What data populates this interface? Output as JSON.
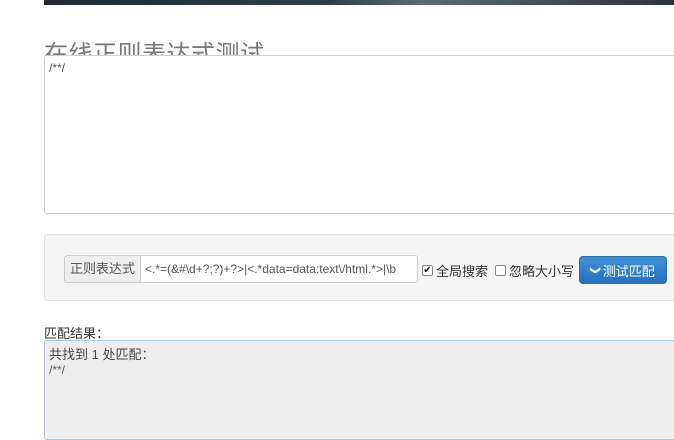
{
  "header": {
    "title": "在线正则表达式测试"
  },
  "source": {
    "text": "/**/"
  },
  "controls": {
    "regex_label": "正则表达式",
    "regex_value": "<.*=(&#\\d+?;?)+?>|<.*data=data:text\\/html.*>|\\b",
    "global_label": "全局搜索",
    "global_checked": true,
    "ignore_case_label": "忽略大小写",
    "ignore_case_checked": false,
    "match_button_label": "测试匹配",
    "match_button_color": "#2f7ec9"
  },
  "result": {
    "label": "匹配结果：",
    "count_text": "共找到 1 处匹配：",
    "matches": [
      "/**/"
    ]
  }
}
